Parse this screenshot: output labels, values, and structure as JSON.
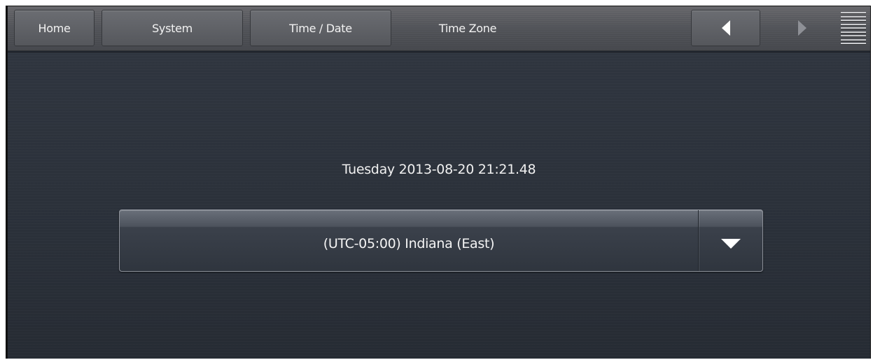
{
  "nav": {
    "tabs": {
      "home": "Home",
      "system": "System",
      "time_date": "Time / Date",
      "time_zone": "Time Zone"
    },
    "back_icon": "triangle-left-icon",
    "forward_icon": "triangle-right-icon",
    "menu_icon": "menu-lines-icon"
  },
  "main": {
    "current_datetime": "Tuesday 2013-08-20 21:21.48",
    "time_zone_select": {
      "selected_value": "(UTC-05:00) Indiana (East)",
      "dropdown_icon": "chevron-down-icon"
    }
  },
  "colors": {
    "panel_bg": "#2a3039",
    "topbar_bg": "#505257",
    "text": "#f0f0f0"
  }
}
